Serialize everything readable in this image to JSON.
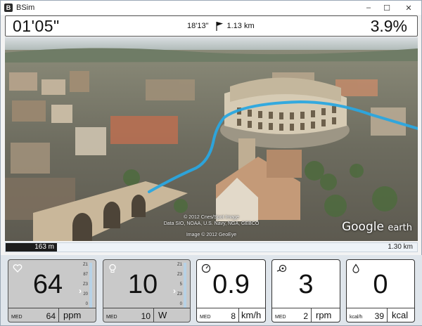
{
  "app": {
    "title": "BSim",
    "icon": "B"
  },
  "window_controls": {
    "minimize": "–",
    "maximize": "☐",
    "close": "✕"
  },
  "stats": {
    "elapsed_time": "01'05\"",
    "remaining_time": "18'13\"",
    "distance": "1.13 km",
    "grade": "3.9%"
  },
  "map": {
    "credit_line1": "© 2012 Cnes/Spot Image",
    "credit_line2": "Data SIO, NOAA, U.S. Navy, NGA, GEBCO",
    "credit_line3": "Image © 2012 GeoEye",
    "logo_main": "Google",
    "logo_sub": "earth"
  },
  "progress": {
    "done_label": "163 m",
    "total_label": "1.30 km",
    "fraction": 0.125
  },
  "tiles": [
    {
      "id": "heart-rate",
      "icon": "heart-icon",
      "value": "64",
      "foot_tag": "MED",
      "foot_value": "64",
      "unit": "ppm",
      "zones": [
        "Z1",
        "87",
        "Z3",
        "20",
        "0"
      ],
      "style": "grey"
    },
    {
      "id": "power",
      "icon": "bulb-icon",
      "value": "10",
      "foot_tag": "MED",
      "foot_value": "10",
      "unit": "W",
      "zones": [
        "Z1",
        "Z3",
        "5",
        "Z3",
        "0"
      ],
      "style": "grey"
    },
    {
      "id": "speed",
      "icon": "speedometer-icon",
      "value": "0.9",
      "foot_tag": "MED",
      "foot_value": "8",
      "unit": "km/h",
      "style": "white"
    },
    {
      "id": "cadence",
      "icon": "crank-icon",
      "value": "3",
      "foot_tag": "MED",
      "foot_value": "2",
      "unit": "rpm",
      "style": "white"
    },
    {
      "id": "calories",
      "icon": "flame-icon",
      "value": "0",
      "foot_tag": "kcal/h",
      "foot_value": "39",
      "unit": "kcal",
      "style": "white"
    }
  ],
  "colors": {
    "route": "#2aa7e0",
    "progress_fill": "#1d1d1d",
    "zone_track": "#b7d2e6"
  }
}
